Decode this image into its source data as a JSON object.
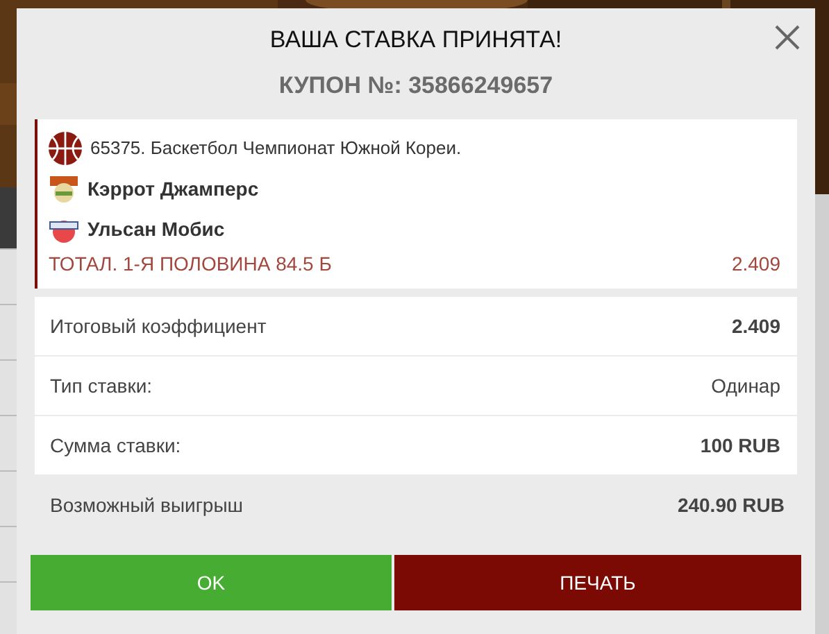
{
  "dialog": {
    "title": "ВАША СТАВКА ПРИНЯТА!",
    "coupon": "КУПОН №: 35866249657"
  },
  "event": {
    "header": "65375. Баскетбол Чемпионат Южной Кореи.",
    "teams": [
      {
        "name": "Кэррот Джамперс",
        "kind": "orange"
      },
      {
        "name": "Ульсан Мобис",
        "kind": "phoebus"
      }
    ],
    "pick": "ТОТАЛ. 1-Я ПОЛОВИНА 84.5 Б",
    "odds": "2.409"
  },
  "summary": [
    {
      "label": "Итоговый коэффициент",
      "value": "2.409",
      "bold": true
    },
    {
      "label": "Тип ставки:",
      "value": "Одинар",
      "bold": false
    },
    {
      "label": "Сумма ставки:",
      "value": "100 RUB",
      "bold": true
    }
  ],
  "payout": {
    "label": "Возможный выигрыш",
    "value": "240.90 RUB"
  },
  "buttons": [
    {
      "label": "OK",
      "kind": "ok"
    },
    {
      "label": "ПЕЧАТЬ",
      "kind": "print"
    }
  ]
}
